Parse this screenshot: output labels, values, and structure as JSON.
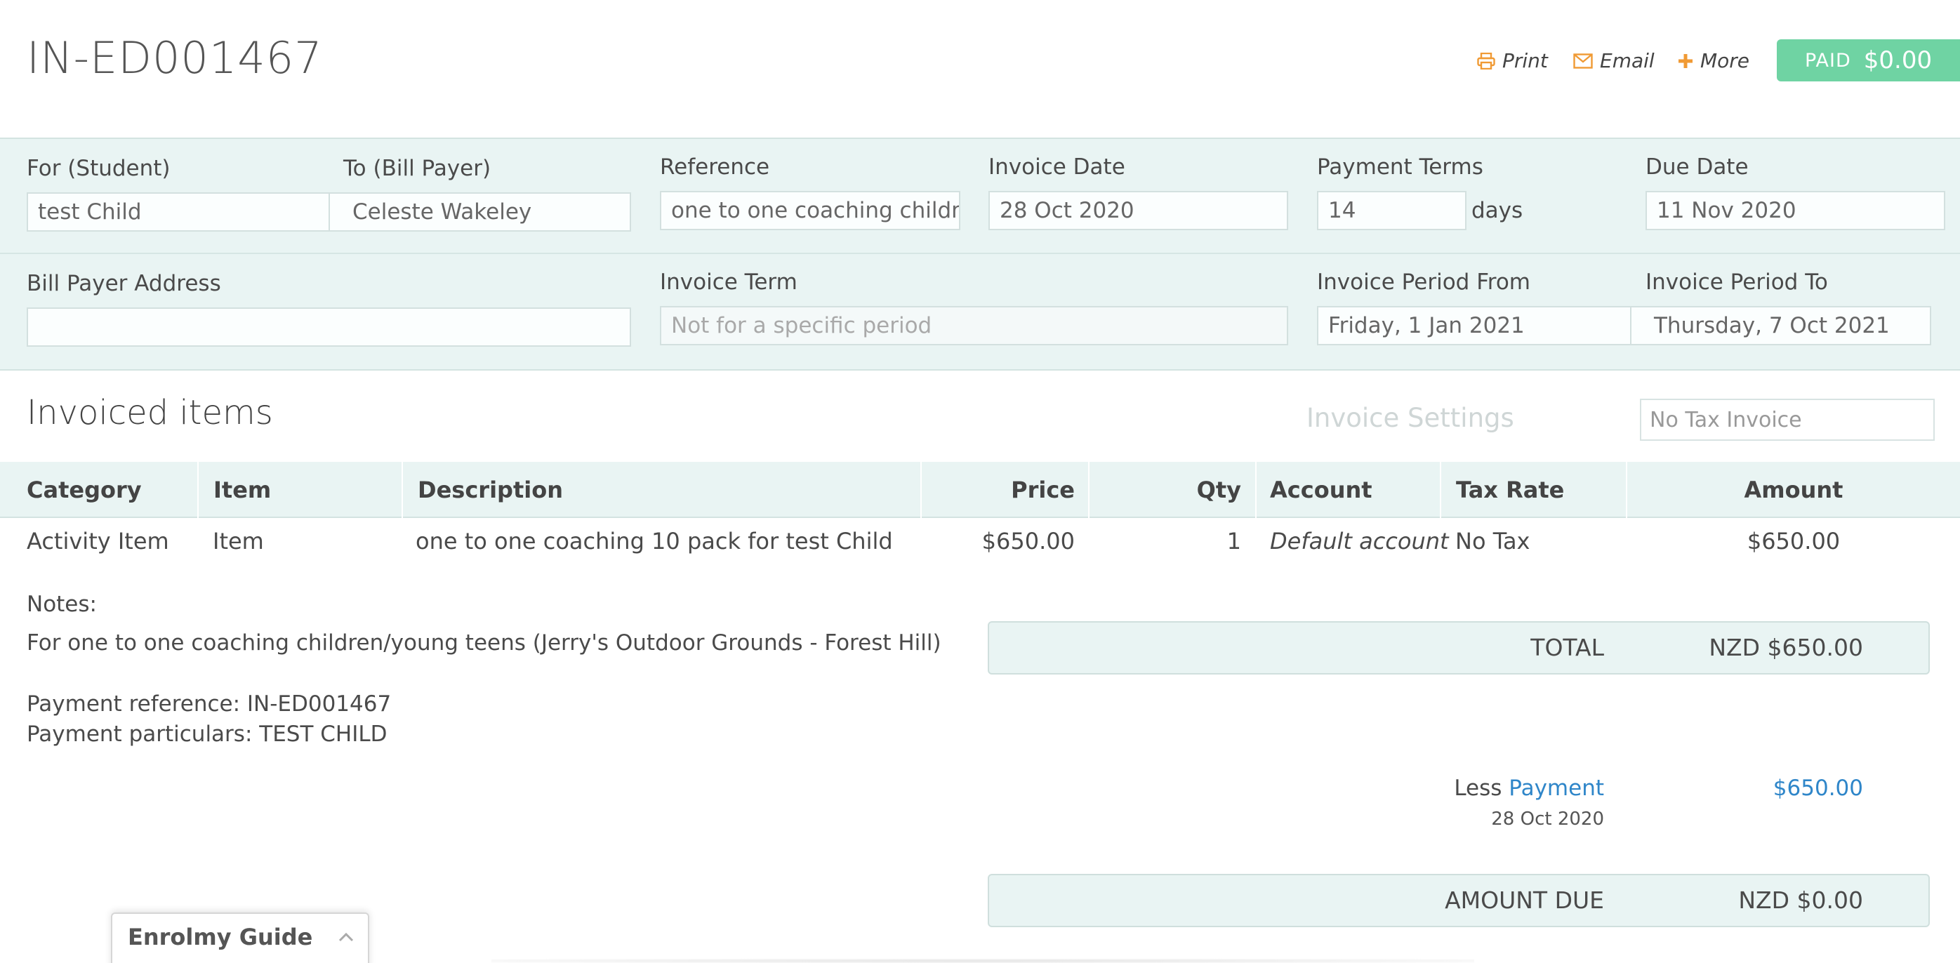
{
  "header": {
    "invoice_number": "IN-ED001467",
    "actions": {
      "print": "Print",
      "email": "Email",
      "more": "More"
    },
    "status_label": "PAID",
    "status_amount": "$0.00"
  },
  "form": {
    "student": {
      "label": "For (Student)",
      "value": "test Child"
    },
    "bill_payer": {
      "label": "To (Bill Payer)",
      "value": "Celeste Wakeley"
    },
    "reference": {
      "label": "Reference",
      "value": "one to one coaching children/young teens (Jerry's Outdoor Grounds - Forest Hill)"
    },
    "invoice_date": {
      "label": "Invoice Date",
      "value": "28 Oct 2020"
    },
    "payment_terms": {
      "label": "Payment Terms",
      "value": "14",
      "suffix": "days"
    },
    "due_date": {
      "label": "Due Date",
      "value": "11 Nov 2020"
    },
    "bill_payer_address": {
      "label": "Bill Payer Address",
      "value": ""
    },
    "invoice_term": {
      "label": "Invoice Term",
      "placeholder": "Not for a specific period"
    },
    "period_from": {
      "label": "Invoice Period From",
      "value": "Friday, 1 Jan 2021"
    },
    "period_to": {
      "label": "Invoice Period To",
      "value": "Thursday, 7 Oct 2021"
    }
  },
  "items_section": {
    "title": "Invoiced items",
    "settings_label": "Invoice Settings",
    "tax_mode": "No Tax Invoice"
  },
  "table": {
    "headers": {
      "category": "Category",
      "item": "Item",
      "description": "Description",
      "price": "Price",
      "qty": "Qty",
      "account": "Account",
      "tax_rate": "Tax Rate",
      "amount": "Amount"
    },
    "rows": [
      {
        "category": "Activity Item",
        "item": "Item",
        "description": "one to one coaching 10 pack for test Child",
        "price": "$650.00",
        "qty": "1",
        "account": "Default account",
        "tax_rate": "No Tax",
        "amount": "$650.00"
      }
    ]
  },
  "notes": {
    "heading": "Notes:",
    "line1": "For one to one coaching children/young teens (Jerry's Outdoor Grounds - Forest Hill)",
    "line2": "Payment reference: IN-ED001467",
    "line3": "Payment particulars: TEST CHILD"
  },
  "totals": {
    "total_label": "TOTAL",
    "total_value": "NZD $650.00",
    "less_label": "Less",
    "payment_link": "Payment",
    "payment_value": "$650.00",
    "payment_date": "28 Oct 2020",
    "due_label": "AMOUNT DUE",
    "due_value": "NZD $0.00"
  },
  "guide": {
    "label": "Enrolmy Guide"
  },
  "colors": {
    "accent_orange": "#f09a34",
    "paid_green": "#6fd3a3",
    "panel_bg": "#e9f4f3",
    "link_blue": "#2f86c9"
  }
}
